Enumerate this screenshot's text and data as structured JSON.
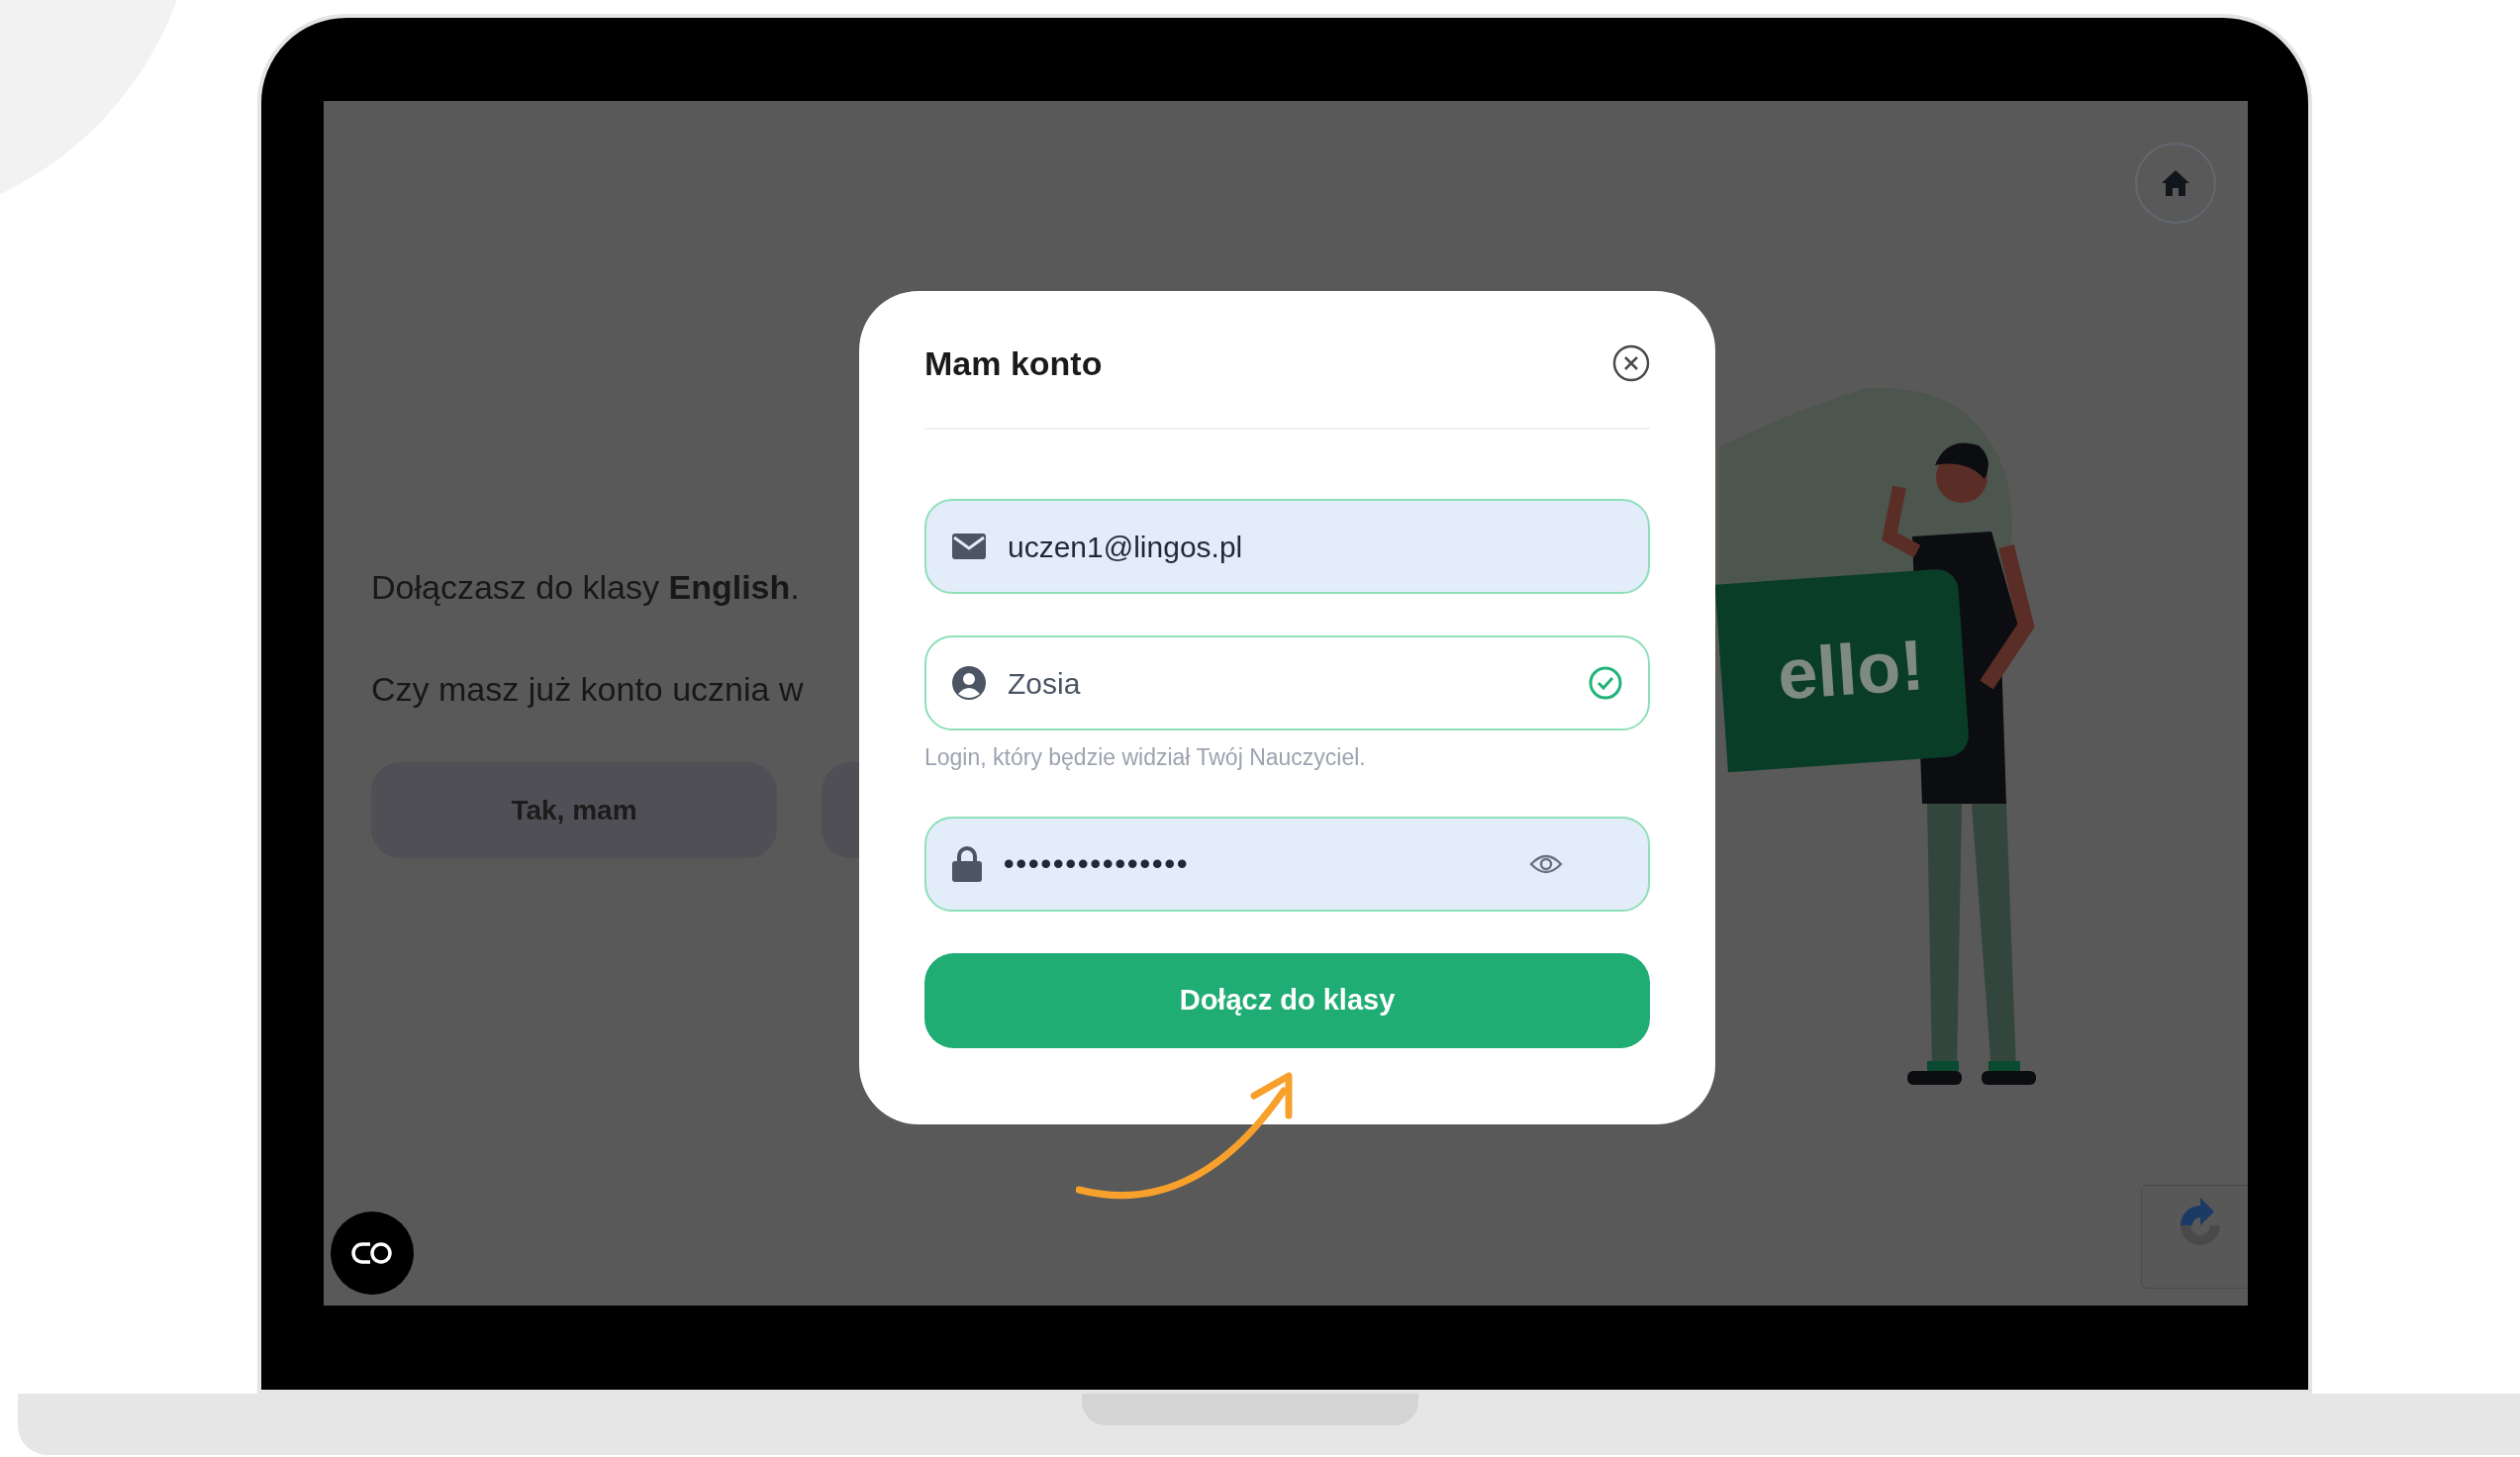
{
  "page": {
    "intro": "Dołączasz do klasy **English**.",
    "question": "Czy masz już konto ucznia w",
    "buttons": [
      {
        "label": "Tak, mam"
      }
    ],
    "sign_text": "ello!"
  },
  "modal": {
    "title": "Mam konto",
    "fields": [
      {
        "kind": "email",
        "value": "uczen1@lingos.pl",
        "autofilled": true,
        "valid": false
      },
      {
        "kind": "user",
        "value": "Zosia",
        "autofilled": false,
        "valid": true,
        "hint": "Login, który będzie widział Twój Nauczyciel."
      },
      {
        "kind": "password",
        "value": "•••••••••••••••",
        "autofilled": true,
        "valid": false
      }
    ],
    "submit": "Dołącz do klasy"
  }
}
